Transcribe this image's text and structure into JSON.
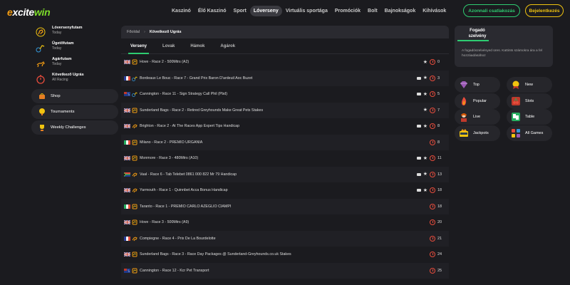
{
  "brand": {
    "logo_e": "e",
    "logo_mid": "xcite",
    "logo_w": "win"
  },
  "nav": [
    {
      "label": "Kaszinó",
      "active": false
    },
    {
      "label": "Élő Kaszinó",
      "active": false
    },
    {
      "label": "Sport",
      "active": false
    },
    {
      "label": "Lóverseny",
      "active": true
    },
    {
      "label": "Virtuális sportága",
      "active": false
    },
    {
      "label": "Promóciók",
      "active": false
    },
    {
      "label": "Bolt",
      "active": false
    },
    {
      "label": "Bajnokságok",
      "active": false
    },
    {
      "label": "Kihívások",
      "active": false
    }
  ],
  "header_buttons": {
    "login": "Azonnali csatlakozás",
    "register": "Bejelentkezés"
  },
  "left_links": [
    {
      "title": "Lóversenyfutam",
      "sub": "Today",
      "icon": "horse-racing-icon"
    },
    {
      "title": "Ügetőfutam",
      "sub": "Today",
      "icon": "harness-icon"
    },
    {
      "title": "Agárfutam",
      "sub": "Today",
      "icon": "greyhound-icon"
    },
    {
      "title": "Következő Ugrás",
      "sub": "All Racing",
      "icon": "stopwatch-icon"
    }
  ],
  "left_pills": [
    {
      "label": "Shop",
      "icon": "shop-icon"
    },
    {
      "label": "Tournaments",
      "icon": "trophy-icon"
    },
    {
      "label": "Weekly Challenges",
      "icon": "challenge-trophy-icon"
    }
  ],
  "breadcrumb": {
    "home": "Főoldal",
    "sep": "›",
    "current": "Következő Ugrás"
  },
  "tabs": [
    {
      "label": "Verseny",
      "active": true
    },
    {
      "label": "Lovak",
      "active": false
    },
    {
      "label": "Hámok",
      "active": false
    },
    {
      "label": "Agárok",
      "active": false
    }
  ],
  "races": [
    {
      "flag": "uk",
      "type": "greyhound",
      "name": "Hove - Race 2 - 500Mtrs (A2)",
      "cam": false,
      "star": true,
      "num": "0"
    },
    {
      "flag": "fr",
      "type": "harness",
      "name": "Bordeaux Le Bouc - Race 7 - Grand Prix Baron D'ardeuil Aoc Buzet",
      "cam": true,
      "star": true,
      "num": "3"
    },
    {
      "flag": "au",
      "type": "harness",
      "name": "Cannington - Race 11 - Sign Strategy Call Phil (Pbd)",
      "cam": true,
      "star": true,
      "num": "5"
    },
    {
      "flag": "uk",
      "type": "greyhound",
      "name": "Sunderland Bags - Race 2 - Retired Greyhounds Make Great Pets Stakes",
      "cam": false,
      "star": true,
      "num": "7"
    },
    {
      "flag": "uk",
      "type": "horse",
      "name": "Brighton - Race 2 - At The Races App Expert Tips Handicap",
      "cam": true,
      "star": true,
      "num": "8"
    },
    {
      "flag": "it",
      "type": "greyhound",
      "name": "Milano - Race 2 - PREMIO URGANIA",
      "cam": false,
      "star": false,
      "num": "8"
    },
    {
      "flag": "uk",
      "type": "greyhound",
      "name": "Monmore - Race 3 - 480Mtrs (A10)",
      "cam": true,
      "star": true,
      "num": "11"
    },
    {
      "flag": "za",
      "type": "horse",
      "name": "Vaal - Race 6 - Tab Telebet 0861 000 822 Mr 79 Handicap",
      "cam": true,
      "star": true,
      "num": "13"
    },
    {
      "flag": "uk",
      "type": "horse",
      "name": "Yarmouth - Race 1 - Quinnbet Acca Bonus Handicap",
      "cam": true,
      "star": true,
      "num": "18"
    },
    {
      "flag": "it",
      "type": "greyhound",
      "name": "Taranto - Race 1 - PREMIO CARLO AZEGLIO CIAMPI",
      "cam": false,
      "star": false,
      "num": "18"
    },
    {
      "flag": "uk",
      "type": "greyhound",
      "name": "Hove - Race 3 - 500Mtrs (A9)",
      "cam": false,
      "star": false,
      "num": "20"
    },
    {
      "flag": "fr",
      "type": "horse",
      "name": "Compiegne - Race 4 - Prix De La Bourdelotte",
      "cam": false,
      "star": false,
      "num": "21"
    },
    {
      "flag": "uk",
      "type": "greyhound",
      "name": "Sunderland Bags - Race 3 - Race Day Packages @ Sunderland-Greyhounds.co.uk Stakes",
      "cam": false,
      "star": false,
      "num": "24"
    },
    {
      "flag": "au",
      "type": "greyhound",
      "name": "Cannington - Race 12 - Kcr Pet Transport",
      "cam": false,
      "star": false,
      "num": "25"
    }
  ],
  "betslip": {
    "title": "Fogadó szelvény",
    "message": "A fogadószelvényed üres. Kattints számokra ára a fel hozzáadásához"
  },
  "games": [
    {
      "label": "Top",
      "icon": "diamond-icon",
      "color": "#7e57c2"
    },
    {
      "label": "New",
      "icon": "new-ribbon-icon",
      "color": "#c0392b"
    },
    {
      "label": "Popular",
      "icon": "fire-icon",
      "color": "#e67e22"
    },
    {
      "label": "Slots",
      "icon": "slot-cherry-icon",
      "color": "#c0392b"
    },
    {
      "label": "Live",
      "icon": "dealer-icon",
      "color": "#d35400"
    },
    {
      "label": "Table",
      "icon": "table-cards-icon",
      "color": "#27ae60"
    },
    {
      "label": "Jackpots",
      "icon": "jackpot-icon",
      "color": "#f1c40f"
    },
    {
      "label": "All Games",
      "icon": "all-games-icon",
      "color": "#8e44ad"
    }
  ]
}
